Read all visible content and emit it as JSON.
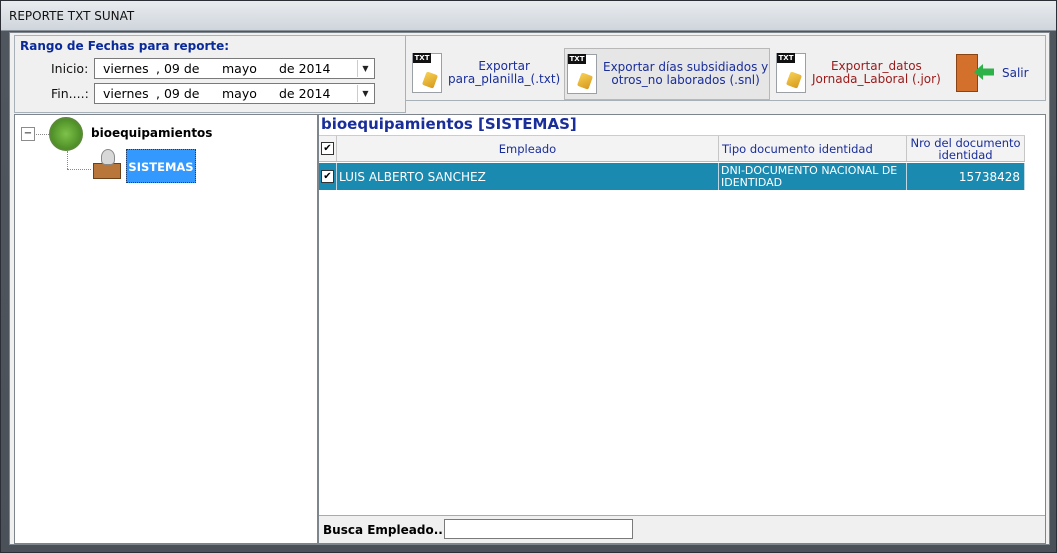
{
  "window": {
    "title": "REPORTE TXT SUNAT"
  },
  "date_range": {
    "title": "Rango de Fechas para reporte:",
    "start_label": "Inicio:",
    "end_label": "Fin....:",
    "start": {
      "weekday": "viernes",
      "day": ", 09 de",
      "month": "mayo",
      "year": "de 2014"
    },
    "end": {
      "weekday": "viernes",
      "day": ", 09 de",
      "month": "mayo",
      "year": "de 2014"
    }
  },
  "toolbar": {
    "export_planilla": {
      "line1": "Exportar",
      "line2": "para_planilla_(.txt)",
      "icon": "txt-file-icon"
    },
    "export_subsidios": {
      "line1": "Exportar días subsidiados y",
      "line2": "otros_no laborados (.snl)",
      "icon": "txt-file-icon"
    },
    "export_jornada": {
      "line1": "Exportar_datos",
      "line2": "Jornada_Laboral (.jor)",
      "icon": "txt-file-icon"
    },
    "exit": {
      "label": "Salir",
      "icon": "exit-door-icon"
    },
    "txt_tag": "TXT"
  },
  "tree": {
    "root": {
      "label": "bioequipamientos",
      "expander": "−"
    },
    "child": {
      "label": "SISTEMAS"
    }
  },
  "grid": {
    "title": "bioequipamientos [SISTEMAS]",
    "columns": {
      "empleado": "Empleado",
      "tipo_doc": "Tipo documento identidad",
      "nro_doc": "Nro del documento identidad"
    },
    "rows": [
      {
        "checked": "✔",
        "empleado": "LUIS ALBERTO SANCHEZ",
        "tipo_doc": "DNI-DOCUMENTO NACIONAL DE IDENTIDAD",
        "nro_doc": "15738428"
      }
    ],
    "header_checked": "✔"
  },
  "search": {
    "label": "Busca Empleado..:",
    "value": ""
  },
  "colors": {
    "accent": "#1a2e9a",
    "selected_row": "#1a8ab0",
    "tree_selection": "#3399ff",
    "export_jornada_text": "#9a1a1a"
  }
}
